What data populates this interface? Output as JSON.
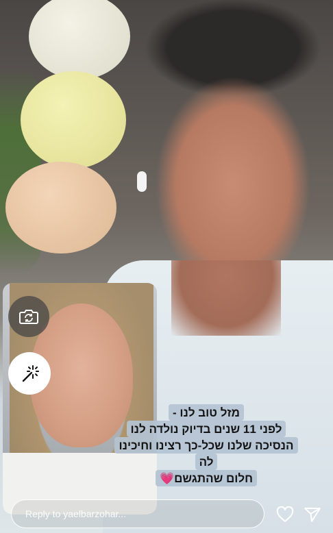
{
  "caption": {
    "lines": [
      "מזל טוב לנו -",
      "לפני 11 שנים בדיוק נולדה לנו",
      "הנסיכה שלנו שכל-כך רצינו וחיכינו",
      "לה",
      "חלום שהתגשם💗"
    ]
  },
  "reply": {
    "placeholder": "Reply to yaelbarzohar..."
  },
  "icons": {
    "flip": "camera-flip-icon",
    "effects": "sparkle-effects-icon",
    "like": "heart-icon",
    "send": "send-icon"
  },
  "colors": {
    "caption_bg": "#b4c3d2",
    "text_light": "#ffffff"
  }
}
